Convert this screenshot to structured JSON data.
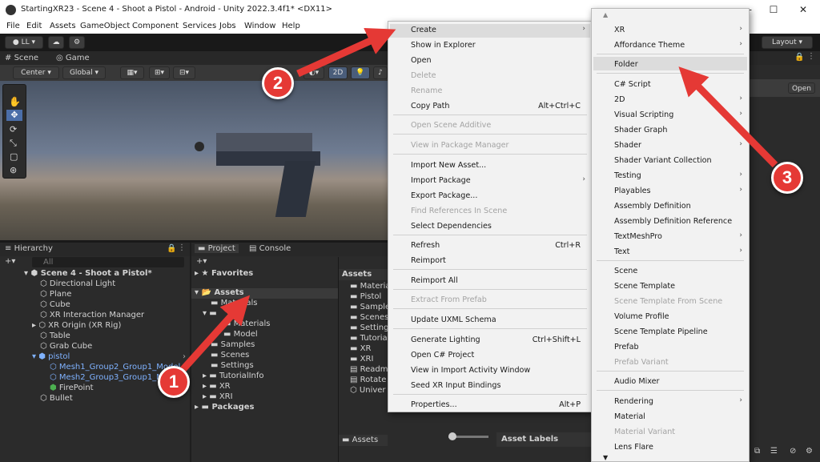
{
  "window": {
    "title": "StartingXR23 - Scene 4 - Shoot a Pistol - Android - Unity 2022.3.4f1* <DX11>",
    "controls": [
      "—",
      "☐",
      "✕"
    ]
  },
  "menubar": [
    "File",
    "Edit",
    "Assets",
    "GameObject",
    "Component",
    "Services",
    "Jobs",
    "Window",
    "Help"
  ],
  "toolbar": {
    "account": "LL",
    "layout": "Layout"
  },
  "scene": {
    "tabs": [
      "Scene",
      "Game"
    ],
    "pivot": "Center",
    "space": "Global",
    "mode_2d": "2D"
  },
  "hierarchy": {
    "tab": "Hierarchy",
    "search_placeholder": "All",
    "scene_name": "Scene 4 - Shoot a Pistol*",
    "items": [
      "Directional Light",
      "Plane",
      "Cube",
      "XR Interaction Manager",
      "XR Origin (XR Rig)",
      "Table",
      "Grab Cube",
      "pistol",
      "Mesh1_Group2_Group1_Model",
      "Mesh2_Group3_Group1_M",
      "FirePoint",
      "Bullet"
    ]
  },
  "project": {
    "tabs": [
      "Project",
      "Console"
    ],
    "favorites": "Favorites",
    "assets": "Assets",
    "tree": [
      "Materials",
      "Materials",
      "Model",
      "Samples",
      "Scenes",
      "Settings",
      "TutorialInfo",
      "XR",
      "XRI"
    ],
    "packages": "Packages",
    "list_header": "Assets",
    "list": [
      "Materia",
      "Pistol",
      "Sample",
      "Scenes",
      "Setting",
      "Tutoria",
      "XR",
      "XRI",
      "Readm",
      "Rotate",
      "Univer"
    ],
    "footer": "Assets"
  },
  "inspector": {
    "open_button": "Open",
    "asset_labels": "Asset Labels"
  },
  "context_menu": {
    "items": [
      {
        "label": "Create",
        "submenu": true
      },
      {
        "label": "Show in Explorer"
      },
      {
        "label": "Open"
      },
      {
        "label": "Delete",
        "disabled": true
      },
      {
        "label": "Rename",
        "disabled": true
      },
      {
        "label": "Copy Path",
        "shortcut": "Alt+Ctrl+C"
      },
      {
        "label": "Open Scene Additive",
        "disabled": true
      },
      {
        "label": "View in Package Manager",
        "disabled": true
      },
      {
        "label": "Import New Asset..."
      },
      {
        "label": "Import Package",
        "submenu": true
      },
      {
        "label": "Export Package..."
      },
      {
        "label": "Find References In Scene",
        "disabled": true
      },
      {
        "label": "Select Dependencies"
      },
      {
        "label": "Refresh",
        "shortcut": "Ctrl+R"
      },
      {
        "label": "Reimport"
      },
      {
        "label": "Reimport All"
      },
      {
        "label": "Extract From Prefab",
        "disabled": true
      },
      {
        "label": "Update UXML Schema"
      },
      {
        "label": "Generate Lighting",
        "shortcut": "Ctrl+Shift+L"
      },
      {
        "label": "Open C# Project"
      },
      {
        "label": "View in Import Activity Window"
      },
      {
        "label": "Seed XR Input Bindings"
      },
      {
        "label": "Properties...",
        "shortcut": "Alt+P"
      }
    ]
  },
  "create_submenu": {
    "items": [
      {
        "label": "XR",
        "submenu": true
      },
      {
        "label": "Affordance Theme",
        "submenu": true
      },
      {
        "label": "Folder",
        "highlighted": true
      },
      {
        "label": "C# Script"
      },
      {
        "label": "2D",
        "submenu": true
      },
      {
        "label": "Visual Scripting",
        "submenu": true
      },
      {
        "label": "Shader Graph"
      },
      {
        "label": "Shader",
        "submenu": true
      },
      {
        "label": "Shader Variant Collection"
      },
      {
        "label": "Testing",
        "submenu": true
      },
      {
        "label": "Playables",
        "submenu": true
      },
      {
        "label": "Assembly Definition"
      },
      {
        "label": "Assembly Definition Reference"
      },
      {
        "label": "TextMeshPro",
        "submenu": true
      },
      {
        "label": "Text",
        "submenu": true
      },
      {
        "label": "Scene"
      },
      {
        "label": "Scene Template"
      },
      {
        "label": "Scene Template From Scene",
        "disabled": true
      },
      {
        "label": "Volume Profile"
      },
      {
        "label": "Scene Template Pipeline"
      },
      {
        "label": "Prefab"
      },
      {
        "label": "Prefab Variant",
        "disabled": true
      },
      {
        "label": "Audio Mixer"
      },
      {
        "label": "Rendering",
        "submenu": true
      },
      {
        "label": "Material"
      },
      {
        "label": "Material Variant",
        "disabled": true
      },
      {
        "label": "Lens Flare"
      }
    ]
  },
  "annotations": [
    "1",
    "2",
    "3"
  ],
  "colors": {
    "accent_red": "#e53935",
    "selection_blue": "#7fb2ff",
    "menu_bg": "#f2f2f2"
  }
}
